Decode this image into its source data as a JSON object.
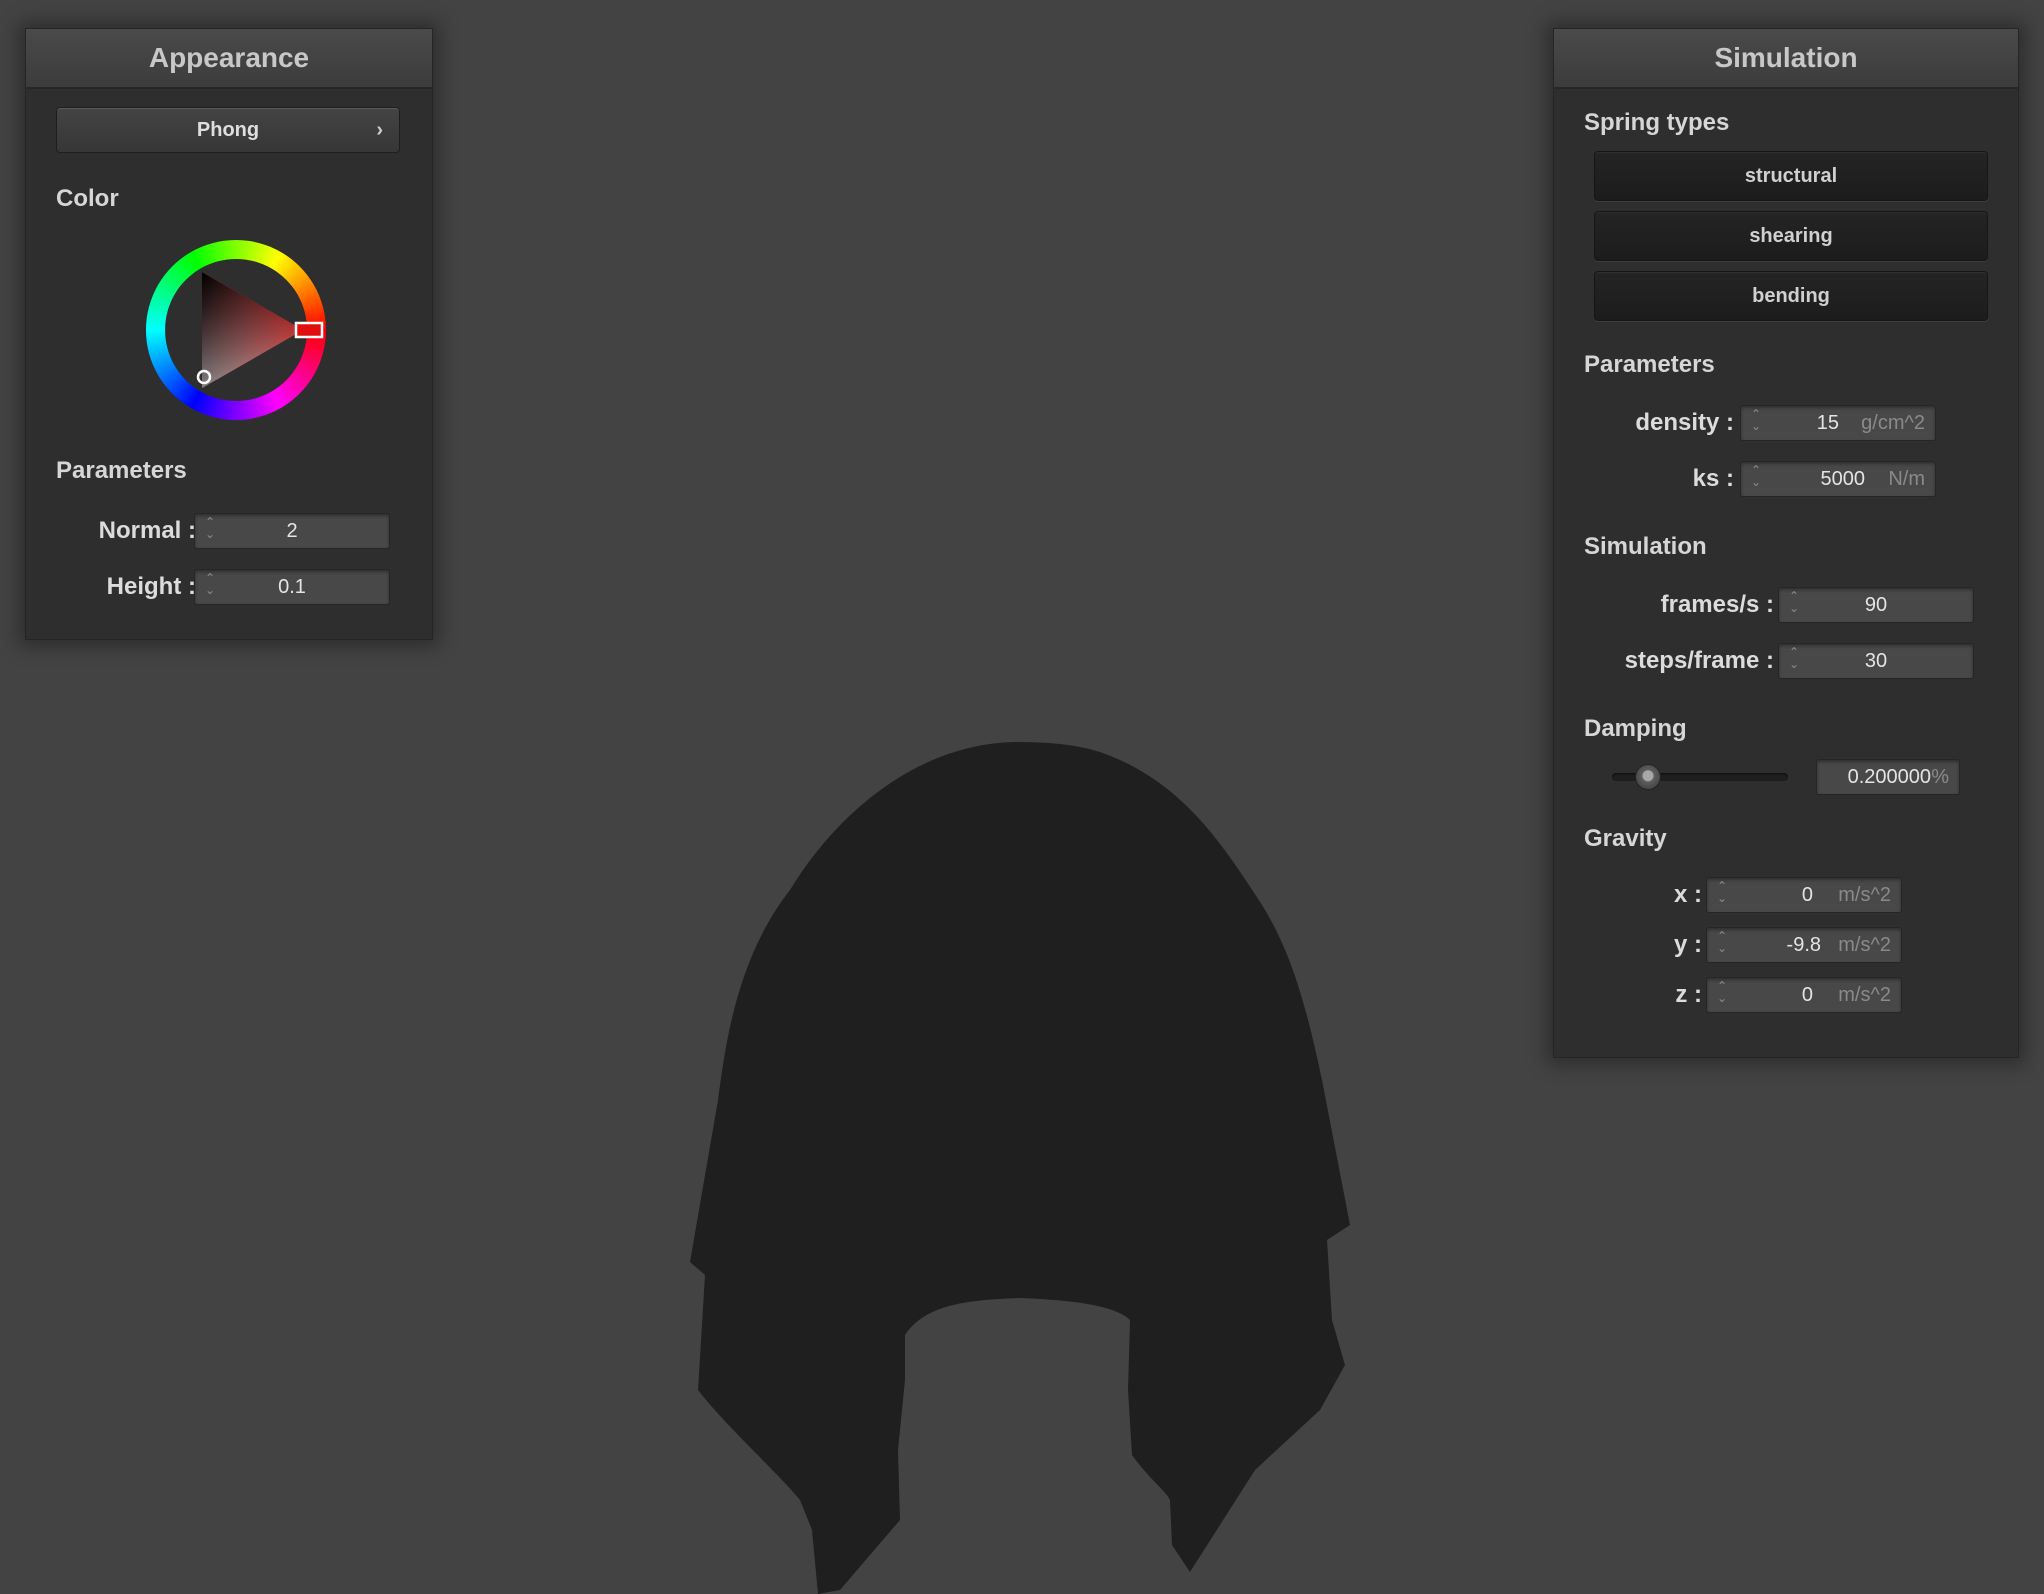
{
  "appearance": {
    "title": "Appearance",
    "shading_model": "Phong",
    "chevron_icon": "chevron-right-icon",
    "color_label": "Color",
    "color_value": "#ff0000",
    "parameters_label": "Parameters",
    "normal": {
      "label": "Normal :",
      "value": "2"
    },
    "height": {
      "label": "Height :",
      "value": "0.1"
    }
  },
  "simulation": {
    "title": "Simulation",
    "spring_types_label": "Spring types",
    "spring_types": [
      "structural",
      "shearing",
      "bending"
    ],
    "parameters_label": "Parameters",
    "density": {
      "label": "density :",
      "value": "15",
      "unit": "g/cm^2"
    },
    "ks": {
      "label": "ks :",
      "value": "5000",
      "unit": "N/m"
    },
    "simulation_label": "Simulation",
    "frames_per_s": {
      "label": "frames/s :",
      "value": "90"
    },
    "steps_per_frame": {
      "label": "steps/frame :",
      "value": "30"
    },
    "damping_label": "Damping",
    "damping": {
      "value": "0.200000",
      "unit": "%",
      "slider_fraction": 0.2
    },
    "gravity_label": "Gravity",
    "gravity": {
      "x": {
        "label": "x :",
        "value": "0",
        "unit": "m/s^2"
      },
      "y": {
        "label": "y :",
        "value": "-9.8",
        "unit": "m/s^2"
      },
      "z": {
        "label": "z :",
        "value": "0",
        "unit": "m/s^2"
      }
    }
  },
  "colors": {
    "background": "#434343",
    "cloth": "#1f1f1f",
    "panel": "#2e2e2e"
  }
}
